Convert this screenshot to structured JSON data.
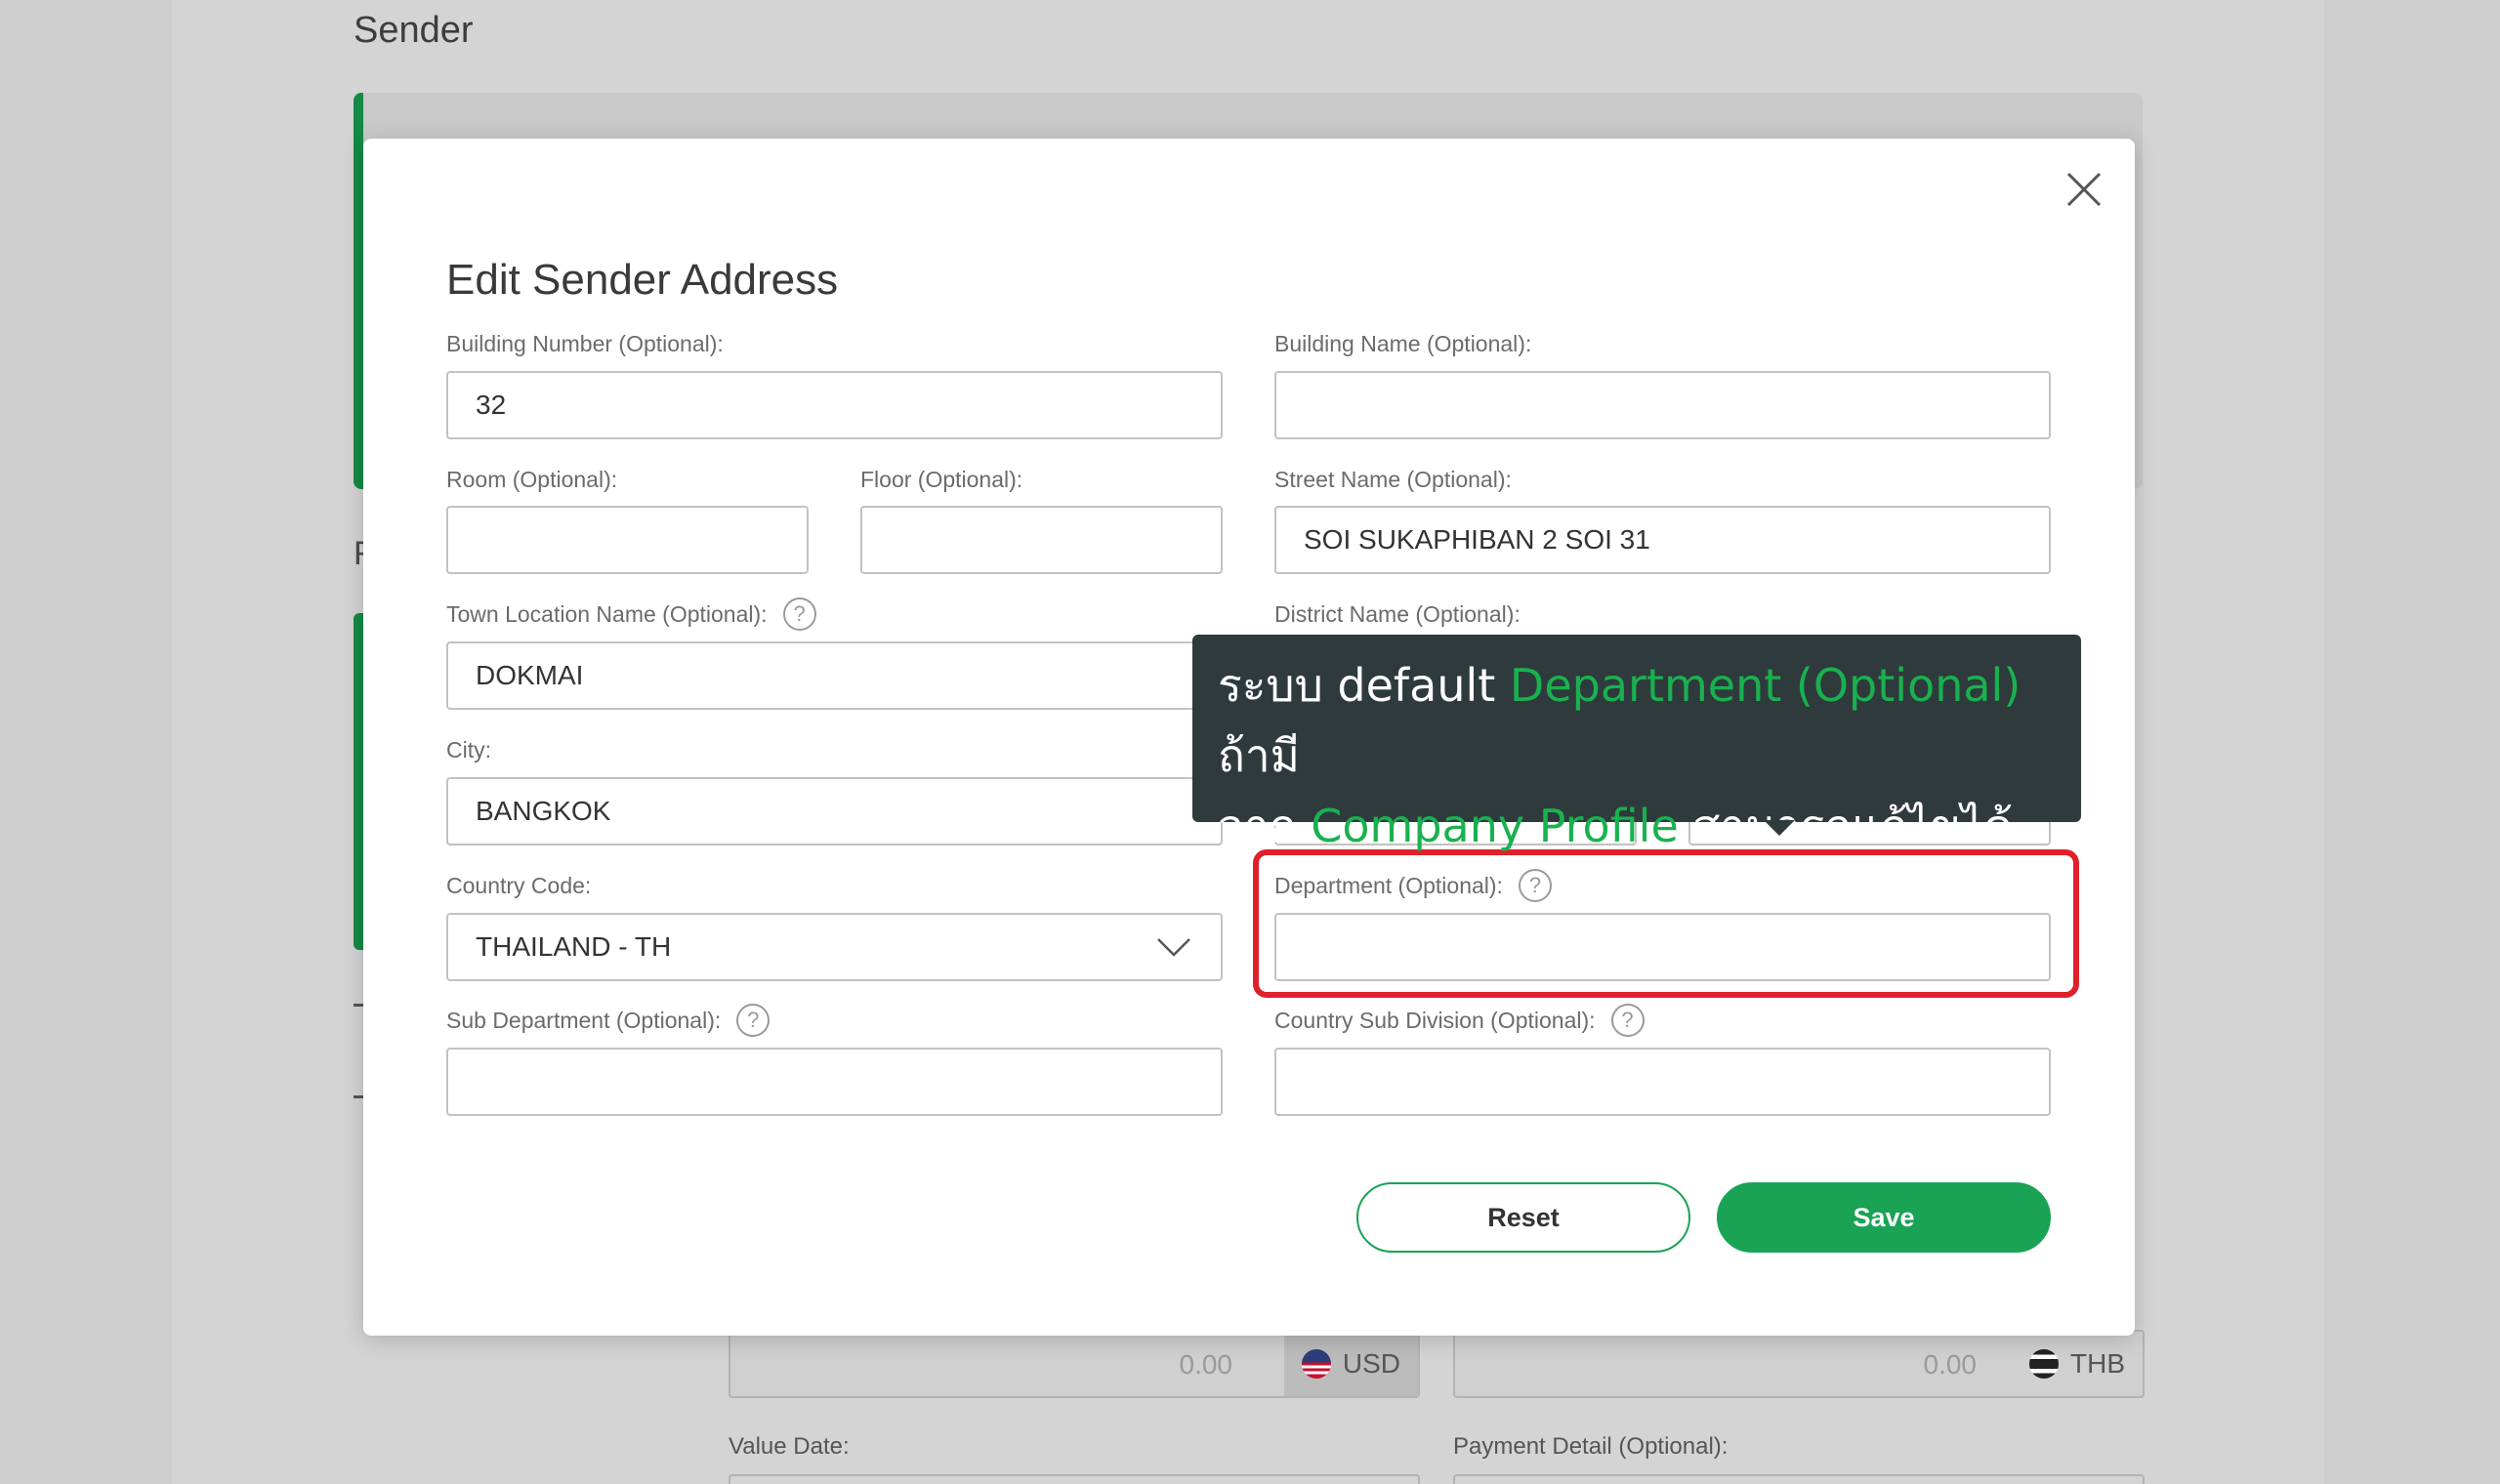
{
  "background": {
    "section_title": "Sender",
    "fragment_letter": "F",
    "amount_left": {
      "value": "0.00",
      "currency": "USD"
    },
    "amount_right": {
      "value": "0.00",
      "currency": "THB"
    },
    "value_date_label": "Value Date:",
    "payment_detail_label": "Payment Detail (Optional):"
  },
  "modal": {
    "title": "Edit Sender Address",
    "close_icon": "close-icon",
    "fields": {
      "building_number": {
        "label": "Building Number (Optional):",
        "value": "32"
      },
      "building_name": {
        "label": "Building Name (Optional):",
        "value": ""
      },
      "room": {
        "label": "Room (Optional):",
        "value": ""
      },
      "floor": {
        "label": "Floor (Optional):",
        "value": ""
      },
      "street_name": {
        "label": "Street Name (Optional):",
        "value": "SOI SUKAPHIBAN 2 SOI 31"
      },
      "town_location": {
        "label": "Town Location Name (Optional):",
        "value": "DOKMAI"
      },
      "district_name": {
        "label": "District Name (Optional):",
        "value": ""
      },
      "city": {
        "label": "City:",
        "value": "BANGKOK"
      },
      "country_code": {
        "label": "Country Code:",
        "value": "THAILAND - TH"
      },
      "department": {
        "label": "Department (Optional):",
        "value": ""
      },
      "sub_department": {
        "label": "Sub Department (Optional):",
        "value": ""
      },
      "country_sub_division": {
        "label": "Country Sub Division (Optional):",
        "value": ""
      }
    },
    "help_glyph": "?",
    "buttons": {
      "reset": "Reset",
      "save": "Save"
    }
  },
  "tooltip": {
    "line1_a": "ระบบ default ",
    "line1_hl": "Department (Optional)",
    "line1_b": " ถ้ามี",
    "line2_a": "จาก ",
    "line2_hl": "Company Profile",
    "line2_b": " สามารถแก้ไขได้"
  },
  "colors": {
    "accent_green": "#1aa255",
    "highlight_red": "#e0202a",
    "tooltip_bg": "#2f3a3d"
  }
}
